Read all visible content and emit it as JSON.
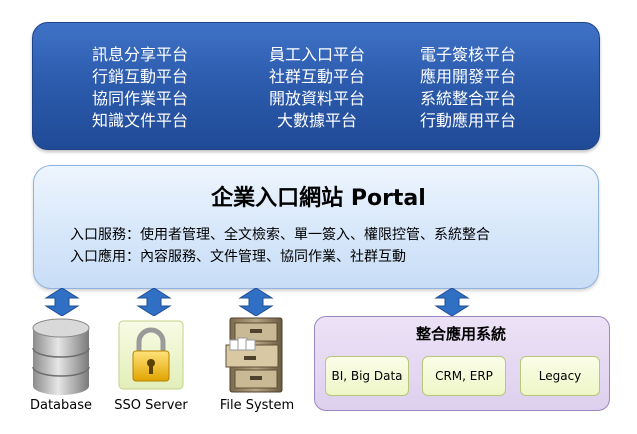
{
  "platforms": {
    "col1": [
      "訊息分享平台",
      "行銷互動平台",
      "協同作業平台",
      "知識文件平台"
    ],
    "col2": [
      "員工入口平台",
      "社群互動平台",
      "開放資料平台",
      "大數據平台"
    ],
    "col3": [
      "電子簽核平台",
      "應用開發平台",
      "系統整合平台",
      "行動應用平台"
    ]
  },
  "portal": {
    "title": "企業入口網站 Portal",
    "line1": "入口服務：使用者管理、全文檢索、單一簽入、權限控管、系統整合",
    "line2": "入口應用：內容服務、文件管理、協同作業、社群互動"
  },
  "bottom": {
    "database": "Database",
    "sso": "SSO Server",
    "filesystem": "File System"
  },
  "integration": {
    "title": "整合應用系統",
    "items": [
      "BI, Big Data",
      "CRM, ERP",
      "Legacy"
    ]
  },
  "colors": {
    "platform_blue": "#2d5cae",
    "arrow_blue": "#2f6fc4",
    "portal_light_blue": "#d7e7fa",
    "integration_purple": "#ddd0ee",
    "item_yellow": "#eef6c6"
  }
}
